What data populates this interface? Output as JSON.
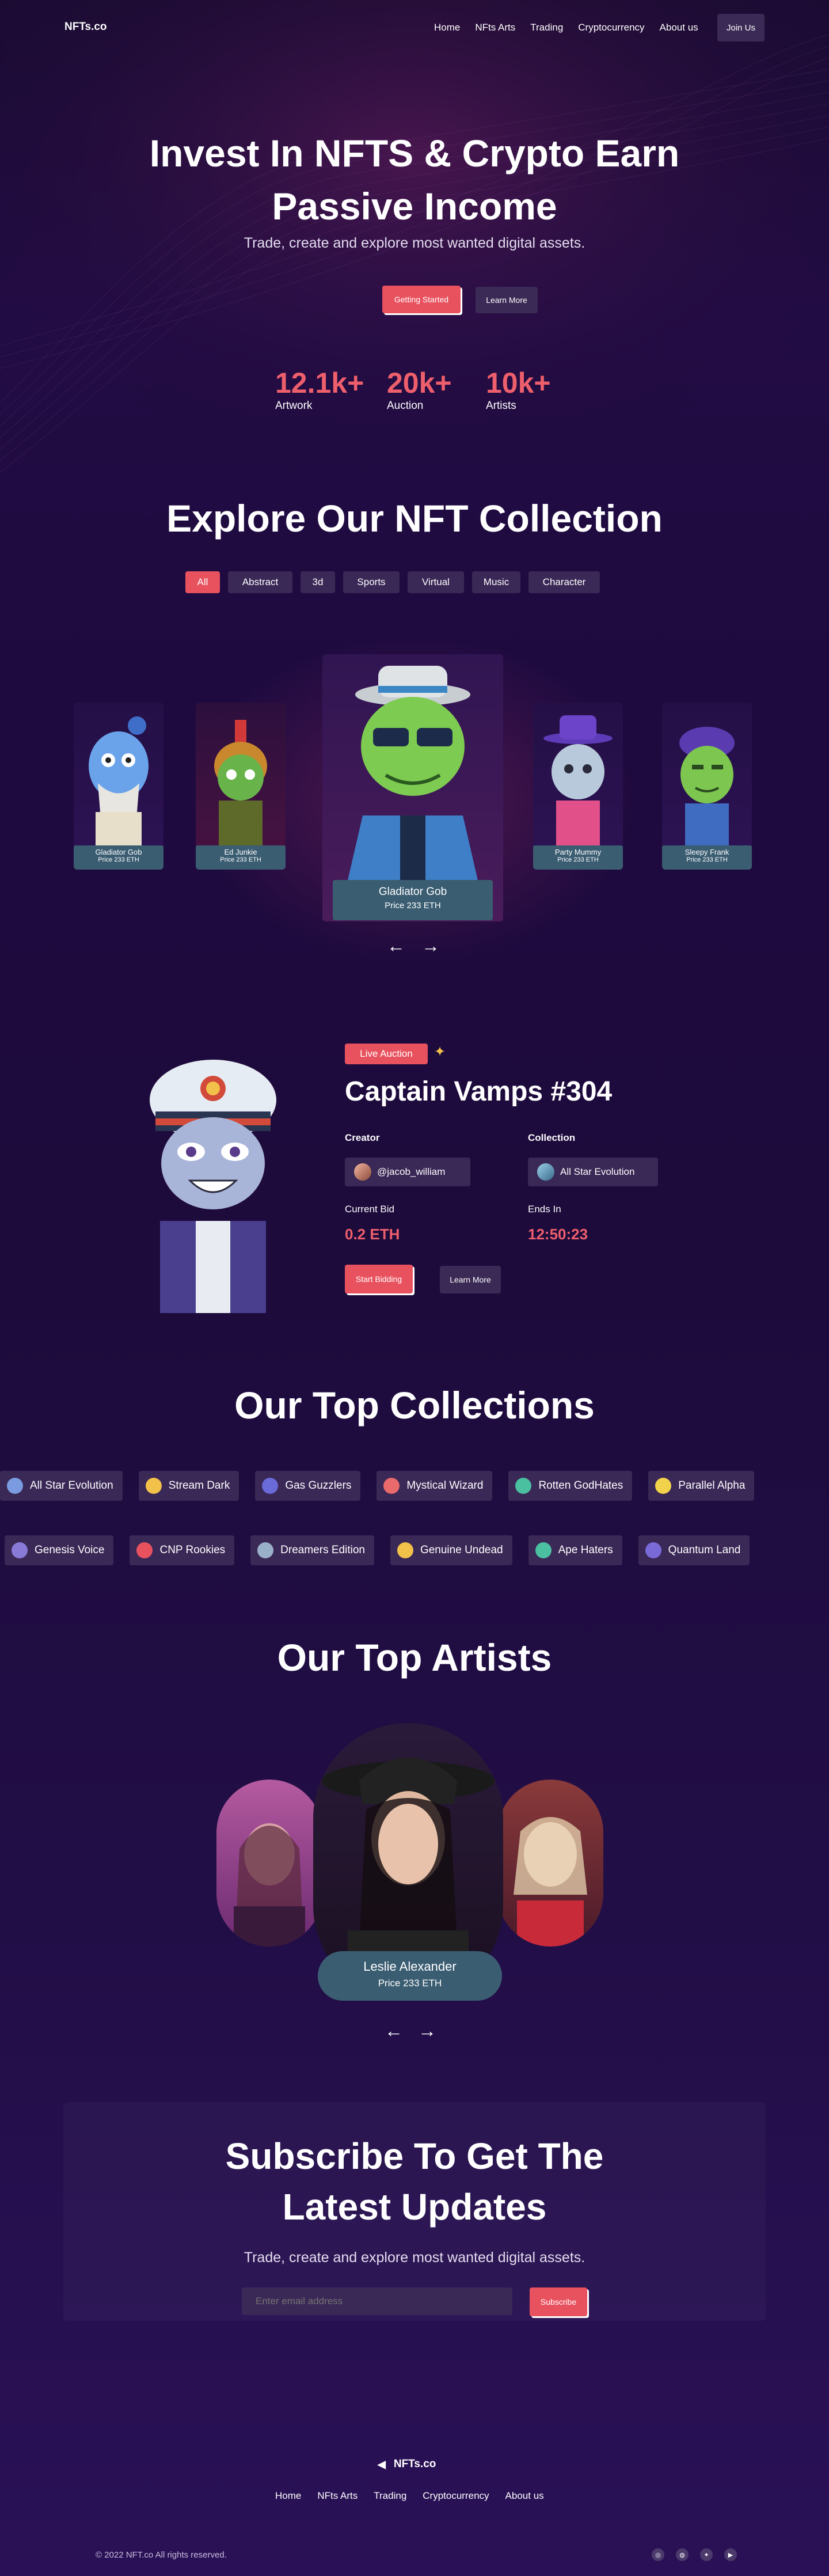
{
  "header": {
    "logo": "NFTs.co",
    "nav": [
      "Home",
      "NFts Arts",
      "Trading",
      "Cryptocurrency",
      "About us"
    ],
    "join": "Join Us"
  },
  "hero": {
    "title_line1": "Invest In NFTS & Crypto Earn",
    "title_line2": "Passive Income",
    "subtitle": "Trade, create and explore most wanted digital assets.",
    "primary_btn": "Getting Started",
    "secondary_btn": "Learn More",
    "stats": [
      {
        "value": "12.1k+",
        "label": "Artwork"
      },
      {
        "value": "20k+",
        "label": "Auction"
      },
      {
        "value": "10k+",
        "label": "Artists"
      }
    ]
  },
  "collection": {
    "title": "Explore Our NFT Collection",
    "filters": [
      "All",
      "Abstract",
      "3d",
      "Sports",
      "Virtual",
      "Music",
      "Character"
    ],
    "cards": [
      {
        "name": "Gladiator Gob",
        "price": "Price 233 ETH"
      },
      {
        "name": "Ed Junkie",
        "price": "Price 233 ETH"
      },
      {
        "name": "Gladiator Gob",
        "price": "Price 233 ETH"
      },
      {
        "name": "Party Mummy",
        "price": "Price 233 ETH"
      },
      {
        "name": "Sleepy Frank",
        "price": "Price 233 ETH"
      }
    ],
    "prev": "←",
    "next": "→"
  },
  "auction": {
    "badge": "Live Auction",
    "title": "Captain Vamps #304",
    "creator_label": "Creator",
    "creator": "@jacob_william",
    "collection_label": "Collection",
    "collection": "All Star Evolution",
    "bid_label": "Current Bid",
    "bid": "0.2 ETH",
    "ends_label": "Ends In",
    "ends": "12:50:23",
    "primary_btn": "Start Bidding",
    "secondary_btn": "Learn More"
  },
  "top_collections": {
    "title": "Our Top Collections",
    "row1": [
      "All Star Evolution",
      "Stream Dark",
      "Gas Guzzlers",
      "Mystical Wizard",
      "Rotten GodHates",
      "Parallel Alpha"
    ],
    "row2": [
      "Genesis Voice",
      "CNP Rookies",
      "Dreamers Edition",
      "Genuine Undead",
      "Ape Haters",
      "Quantum Land"
    ]
  },
  "artists": {
    "title": "Our Top Artists",
    "featured_name": "Leslie Alexander",
    "featured_price": "Price 233 ETH",
    "prev": "←",
    "next": "→"
  },
  "subscribe": {
    "title_line1": "Subscribe To Get The",
    "title_line2": "Latest Updates",
    "subtitle": "Trade, create and explore most wanted digital assets.",
    "placeholder": "Enter email address",
    "button": "Subscribe"
  },
  "footer": {
    "logo": "NFTs.co",
    "nav": [
      "Home",
      "NFts Arts",
      "Trading",
      "Cryptocurrency",
      "About us"
    ],
    "copyright": "© 2022 NFT.co All rights reserved.",
    "social_icons": [
      "instagram-icon",
      "dribbble-icon",
      "twitter-icon",
      "youtube-icon"
    ]
  }
}
